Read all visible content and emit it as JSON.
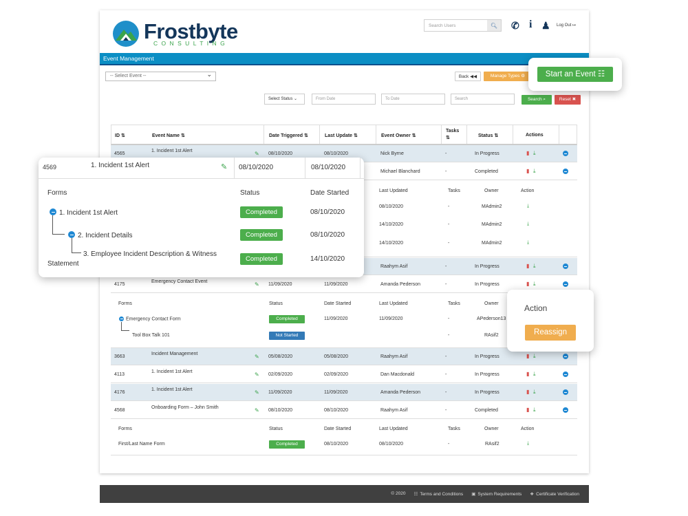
{
  "header": {
    "logo_name": "Frostbyte",
    "logo_sub": "CONSULTING",
    "search_placeholder": "Search Users",
    "logout": "Log Out",
    "bar_title": "Event Management"
  },
  "toolbar": {
    "select_event": "-- Select Event --",
    "back": "Back",
    "manage_types": "Manage Types",
    "select_status": "Select Status",
    "from_date": "From Date",
    "to_date": "To Date",
    "search": "Search",
    "search_btn": "Search",
    "reset": "Reset"
  },
  "start_event": "Start an Event",
  "table": {
    "headers": [
      "ID",
      "Event Name",
      "Date Triggered",
      "Last Update",
      "Event Owner",
      "Tasks",
      "Status",
      "Actions"
    ],
    "sub_headers": [
      "Forms",
      "Status",
      "Date Started",
      "Last Updated",
      "Tasks",
      "Owner",
      "Action"
    ],
    "rows": [
      {
        "id": "4565",
        "name": "1. Incident 1st Alert",
        "triggered": "08/10/2020",
        "updated": "08/10/2020",
        "owner": "Nick Byrne",
        "tasks": "-",
        "status": "In Progress"
      },
      {
        "id": "4569",
        "name": "1. Incident 1st Alert",
        "triggered": "08/10/2020",
        "updated": "08/10/2020",
        "owner": "Michael Blanchard",
        "tasks": "-",
        "status": "Completed"
      },
      {
        "id": "",
        "name": "",
        "triggered": "",
        "updated": "",
        "owner": "Raahym Asif",
        "tasks": "-",
        "status": "In Progress"
      },
      {
        "id": "4175",
        "name": "Emergency Contact Event",
        "triggered": "11/09/2020",
        "updated": "11/09/2020",
        "owner": "Amanda Pederson",
        "tasks": "-",
        "status": "In Progress"
      },
      {
        "id": "3663",
        "name": "Incident Management",
        "triggered": "05/08/2020",
        "updated": "05/08/2020",
        "owner": "Raahym Asif",
        "tasks": "-",
        "status": "In Progress"
      },
      {
        "id": "4113",
        "name": "1. Incident 1st Alert",
        "triggered": "02/09/2020",
        "updated": "02/09/2020",
        "owner": "Dan Macdonald",
        "tasks": "-",
        "status": "In Progress"
      },
      {
        "id": "4176",
        "name": "1. Incident 1st Alert",
        "triggered": "11/09/2020",
        "updated": "11/09/2020",
        "owner": "Amanda Pederson",
        "tasks": "-",
        "status": "In Progress"
      },
      {
        "id": "4568",
        "name": "Onboarding Form – John Smith",
        "triggered": "08/10/2020",
        "updated": "08/10/2020",
        "owner": "Raahym Asif",
        "tasks": "-",
        "status": "Completed"
      }
    ],
    "sub_4569": [
      {
        "updated": "08/10/2020",
        "tasks": "-",
        "owner": "MAdmin2"
      },
      {
        "updated": "14/10/2020",
        "tasks": "-",
        "owner": "MAdmin2"
      },
      {
        "updated": "14/10/2020",
        "tasks": "-",
        "owner": "MAdmin2"
      }
    ],
    "sub_4175": [
      {
        "form": "Emergency Contact Form",
        "status": "Completed",
        "started": "11/09/2020",
        "updated": "11/09/2020",
        "tasks": "-",
        "owner": "APederson13"
      },
      {
        "form": "Tool Box Talk 101",
        "status": "Not Started",
        "started": "",
        "updated": "",
        "tasks": "-",
        "owner": "RAsif2"
      }
    ],
    "sub_4568": [
      {
        "form": "First/Last Name Form",
        "status": "Completed",
        "started": "08/10/2020",
        "updated": "08/10/2020",
        "tasks": "-",
        "owner": "RAsif2"
      }
    ]
  },
  "zoom_card": {
    "id": "4569",
    "name": "1. Incident 1st Alert",
    "triggered": "08/10/2020",
    "updated": "08/10/2020",
    "col_forms": "Forms",
    "col_status": "Status",
    "col_started": "Date Started",
    "forms": [
      {
        "name": "1. Incident 1st Alert",
        "status": "Completed",
        "started": "08/10/2020"
      },
      {
        "name": "2. Incident Details",
        "status": "Completed",
        "started": "08/10/2020"
      },
      {
        "name": "3. Employee Incident Description & Witness",
        "name2": "Statement",
        "status": "Completed",
        "started": "14/10/2020"
      }
    ]
  },
  "action_card": {
    "title": "Action",
    "button": "Reassign"
  },
  "footer": {
    "copyright": "© 2020",
    "terms": "Terms and Conditions",
    "requirements": "System Requirements",
    "certificate": "Certificate Verification"
  },
  "colors": {
    "brand_blue": "#0b8ec4",
    "navy": "#14365a",
    "green": "#4cae4c",
    "orange": "#f0ad4e",
    "red": "#d9534f"
  }
}
